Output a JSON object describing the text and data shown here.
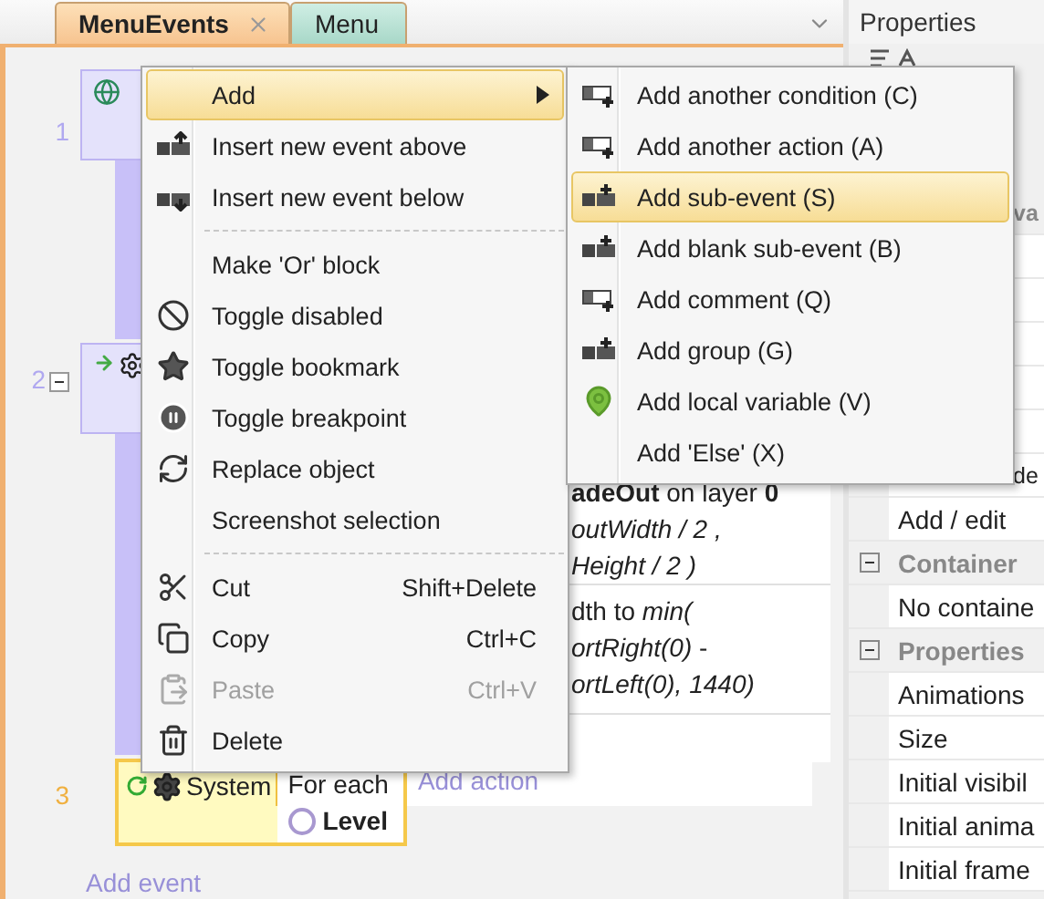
{
  "tabs": [
    {
      "label": "MenuEvents",
      "selected": true,
      "closable": true
    },
    {
      "label": "Menu",
      "selected": false,
      "closable": false
    }
  ],
  "event_sheet": {
    "events": [
      {
        "number": "1",
        "selected": false
      },
      {
        "number": "2",
        "selected": false,
        "expanded": true,
        "actions": [
          {
            "lines": [
              "**adeOut** on layer **0**",
              "*outWidth / 2 ,*",
              "*Height / 2 )*"
            ]
          },
          {
            "lines": [
              "dth to *min(*",
              "*ortRight(0)* -",
              "*ortLeft(0), 1440)*"
            ]
          }
        ]
      },
      {
        "number": "3",
        "selected": true,
        "object": "System",
        "condition": "For each",
        "parameter": "Level",
        "add_action": "Add action"
      }
    ],
    "add_event": "Add event"
  },
  "context_menu": {
    "items": [
      {
        "kind": "item",
        "label": "Add",
        "selected": true,
        "submenu": true,
        "disabled": false
      },
      {
        "kind": "item",
        "label": "Insert new event above",
        "selected": false,
        "disabled": false
      },
      {
        "kind": "item",
        "label": "Insert new event below",
        "selected": false,
        "disabled": false
      },
      {
        "kind": "separator"
      },
      {
        "kind": "item",
        "label": "Make 'Or' block",
        "selected": false,
        "disabled": false
      },
      {
        "kind": "item",
        "label": "Toggle disabled",
        "selected": false,
        "disabled": false
      },
      {
        "kind": "item",
        "label": "Toggle bookmark",
        "selected": false,
        "disabled": false
      },
      {
        "kind": "item",
        "label": "Toggle breakpoint",
        "selected": false,
        "disabled": false
      },
      {
        "kind": "item",
        "label": "Replace object",
        "selected": false,
        "disabled": false
      },
      {
        "kind": "item",
        "label": "Screenshot selection",
        "selected": false,
        "disabled": false
      },
      {
        "kind": "separator"
      },
      {
        "kind": "item",
        "label": "Cut",
        "shortcut": "Shift+Delete",
        "selected": false,
        "disabled": false
      },
      {
        "kind": "item",
        "label": "Copy",
        "shortcut": "Ctrl+C",
        "selected": false,
        "disabled": false
      },
      {
        "kind": "item",
        "label": "Paste",
        "shortcut": "Ctrl+V",
        "selected": false,
        "disabled": true
      },
      {
        "kind": "item",
        "label": "Delete",
        "selected": false,
        "disabled": false
      }
    ]
  },
  "submenu": {
    "items": [
      {
        "label": "Add another condition (C)",
        "selected": false
      },
      {
        "label": "Add another action (A)",
        "selected": false
      },
      {
        "label": "Add sub-event (S)",
        "selected": true
      },
      {
        "label": "Add blank sub-event (B)",
        "selected": false
      },
      {
        "label": "Add comment (Q)",
        "selected": false
      },
      {
        "label": "Add group (G)",
        "selected": false
      },
      {
        "label": "Add local variable (V)",
        "selected": false
      },
      {
        "label": "Add 'Else' (X)",
        "selected": false
      }
    ]
  },
  "properties_panel": {
    "title": "Properties",
    "rows": [
      {
        "kind": "header",
        "label": "va"
      },
      {
        "kind": "blank"
      },
      {
        "kind": "blank"
      },
      {
        "kind": "blank"
      },
      {
        "kind": "blank"
      },
      {
        "kind": "blank"
      },
      {
        "kind": "value",
        "label": "de"
      },
      {
        "kind": "value",
        "label": "Add / edit"
      },
      {
        "kind": "header",
        "label": "Container",
        "expanded": true
      },
      {
        "kind": "value",
        "label": "No containe"
      },
      {
        "kind": "header",
        "label": "Properties",
        "expanded": true
      },
      {
        "kind": "value",
        "label": "Animations"
      },
      {
        "kind": "value",
        "label": "Size"
      },
      {
        "kind": "value",
        "label": "Initial visibil"
      },
      {
        "kind": "value",
        "label": "Initial anima"
      },
      {
        "kind": "value",
        "label": "Initial frame"
      }
    ]
  }
}
